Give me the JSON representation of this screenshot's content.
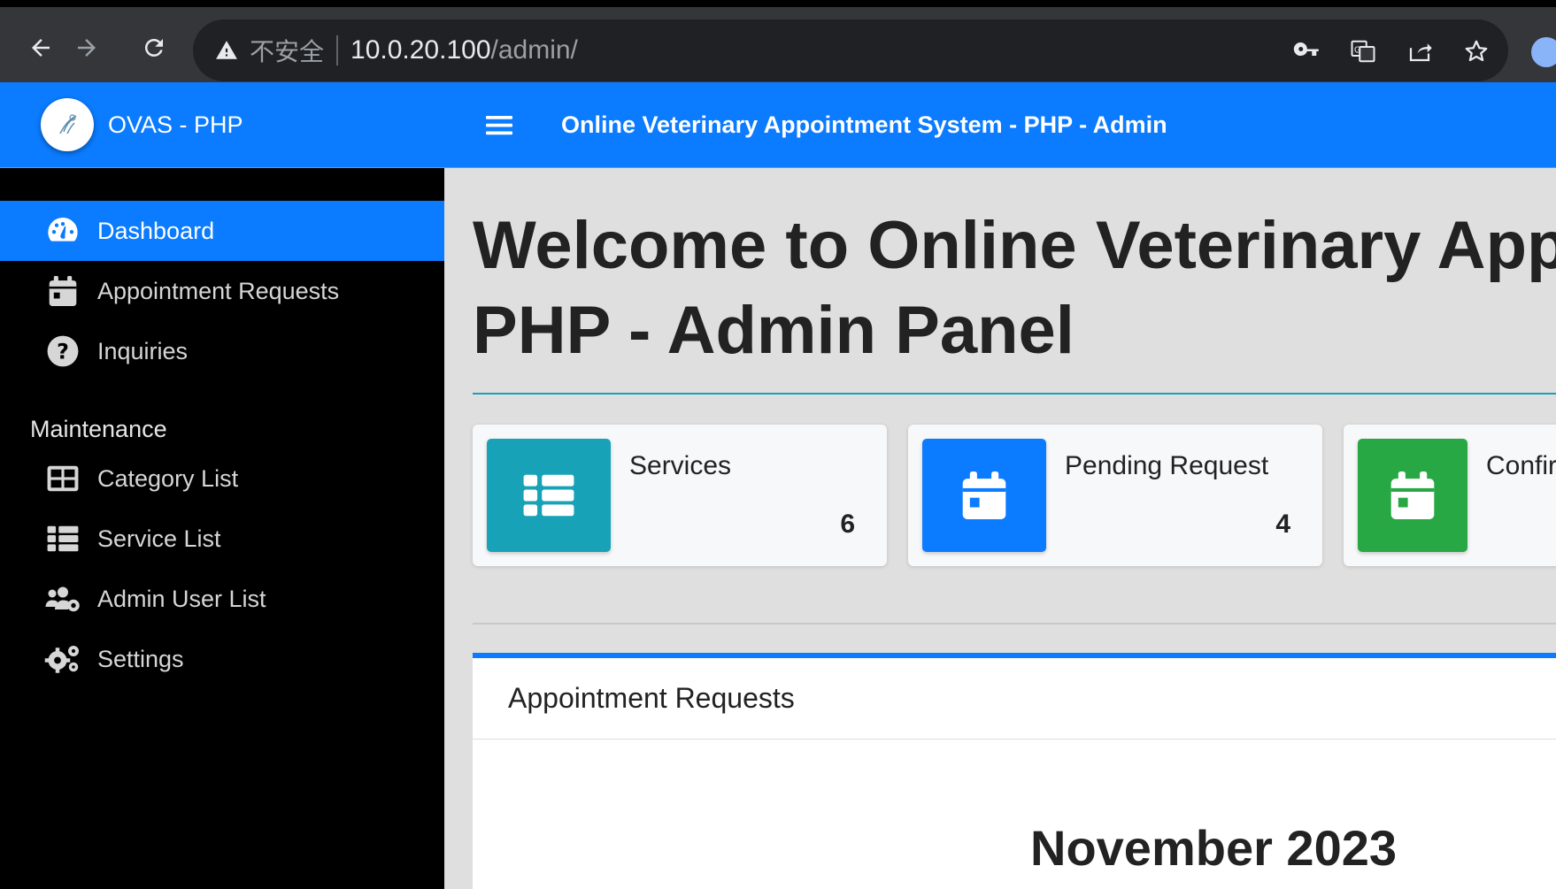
{
  "browser": {
    "security_label": "不安全",
    "url_host": "10.0.20.100",
    "url_path": "/admin/"
  },
  "sidebar": {
    "brand": "OVAS - PHP",
    "items": [
      {
        "label": "Dashboard",
        "icon": "dashboard-icon",
        "active": true
      },
      {
        "label": "Appointment Requests",
        "icon": "calendar-icon"
      },
      {
        "label": "Inquiries",
        "icon": "question-circle-icon"
      }
    ],
    "maintenance_header": "Maintenance",
    "maintenance_items": [
      {
        "label": "Category List",
        "icon": "th-large-icon"
      },
      {
        "label": "Service List",
        "icon": "th-list-icon"
      },
      {
        "label": "Admin User List",
        "icon": "users-cog-icon"
      },
      {
        "label": "Settings",
        "icon": "cogs-icon"
      }
    ]
  },
  "topbar": {
    "title": "Online Veterinary Appointment System - PHP - Admin"
  },
  "main": {
    "welcome_line1": "Welcome to Online Veterinary Appointment System -",
    "welcome_line2": "PHP - Admin Panel",
    "cards": [
      {
        "label": "Services",
        "value": "6",
        "color": "#17a2b8",
        "icon": "th-list-icon"
      },
      {
        "label": "Pending Request",
        "value": "4",
        "color": "#0b7bff",
        "icon": "calendar-day-icon"
      },
      {
        "label": "Confirmed Request",
        "value": "",
        "color": "#28a745",
        "icon": "calendar-day-icon"
      }
    ],
    "panel_title": "Appointment Requests",
    "calendar_month": "November 2023"
  },
  "colors": {
    "primary": "#0b7bff",
    "info": "#17a2b8",
    "success": "#28a745"
  }
}
